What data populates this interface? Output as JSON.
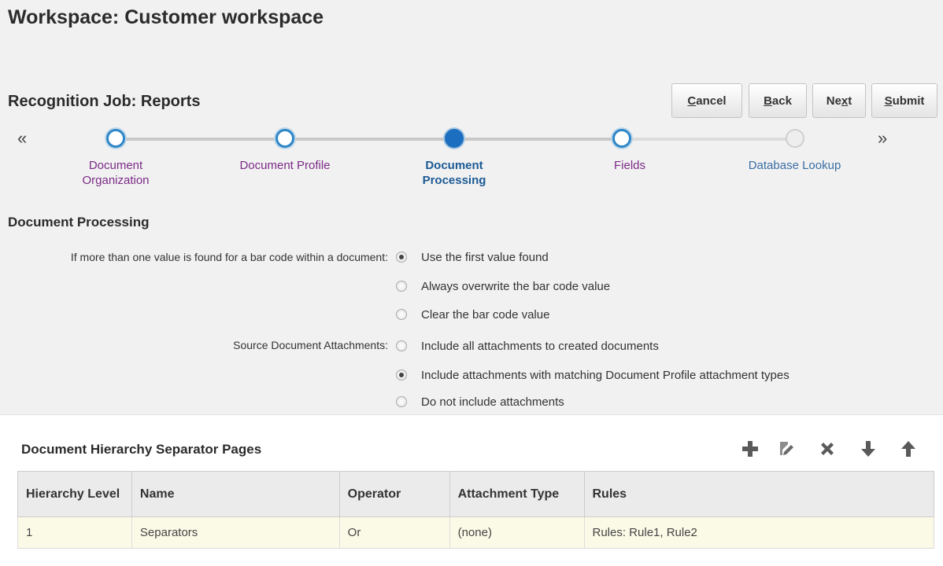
{
  "workspace": {
    "title": "Workspace: Customer workspace"
  },
  "job": {
    "title": "Recognition Job: Reports"
  },
  "buttons": {
    "cancel": {
      "pre": "",
      "key": "C",
      "post": "ancel"
    },
    "back": {
      "pre": "",
      "key": "B",
      "post": "ack"
    },
    "next": {
      "pre": "Ne",
      "key": "x",
      "post": "t"
    },
    "submit": {
      "pre": "",
      "key": "S",
      "post": "ubmit"
    }
  },
  "train": {
    "prev_arrow": "«",
    "next_arrow": "»",
    "stops": [
      {
        "label": "Document Organization",
        "state": "visited"
      },
      {
        "label": "Document Profile",
        "state": "visited"
      },
      {
        "label": "Document Processing",
        "state": "current"
      },
      {
        "label": "Fields",
        "state": "visited"
      },
      {
        "label": "Database Lookup",
        "state": "unvisited"
      }
    ]
  },
  "processing": {
    "title": "Document Processing",
    "barcode": {
      "label": "If more than one value is found for a bar code within a document:",
      "options": [
        {
          "label": "Use the first value found",
          "checked": true
        },
        {
          "label": "Always overwrite the bar code value",
          "checked": false
        },
        {
          "label": "Clear the bar code value",
          "checked": false
        }
      ]
    },
    "attachments": {
      "label": "Source Document Attachments:",
      "options": [
        {
          "label": "Include all attachments to created documents",
          "checked": false
        },
        {
          "label": "Include attachments with matching Document Profile attachment types",
          "checked": true
        },
        {
          "label": "Do not include attachments",
          "checked": false
        }
      ]
    }
  },
  "separator_pages": {
    "title": "Document Hierarchy Separator Pages",
    "toolbar": [
      "add-icon",
      "edit-icon",
      "delete-icon",
      "move-down-icon",
      "move-up-icon"
    ],
    "columns": [
      "Hierarchy Level",
      "Name",
      "Operator",
      "Attachment Type",
      "Rules"
    ],
    "rows": [
      [
        "1",
        "Separators",
        "Or",
        "(none)",
        "Rules: Rule1, Rule2"
      ]
    ]
  }
}
